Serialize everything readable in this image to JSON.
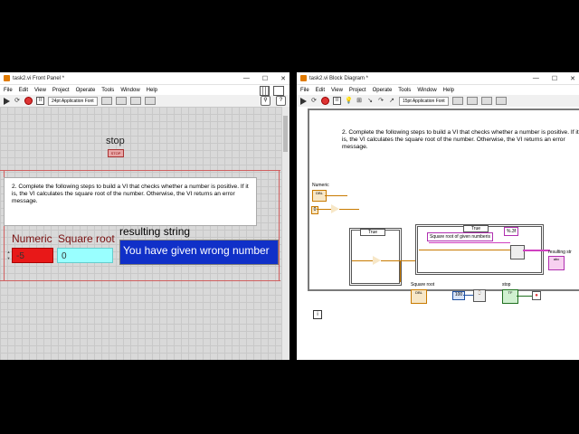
{
  "front_panel": {
    "title": "task2.vi Front Panel *",
    "menu": [
      "File",
      "Edit",
      "View",
      "Project",
      "Operate",
      "Tools",
      "Window",
      "Help"
    ],
    "font_select": "24pt Application Font",
    "stop_label": "stop",
    "stop_button_text": "STOP",
    "instructions": "2.  Complete the following steps to build a VI that checks whether a number is positive. If it is, the VI calculates the square root of the number. Otherwise, the VI returns an error message.",
    "numeric_label": "Numeric",
    "numeric_value": "-5",
    "square_root_label": "Square root",
    "square_root_value": "0",
    "resulting_string_label": "resulting string",
    "resulting_string_value": "You have given wrong number"
  },
  "block_diagram": {
    "title": "task2.vi Block Diagram *",
    "menu": [
      "File",
      "Edit",
      "View",
      "Project",
      "Operate",
      "Tools",
      "Window",
      "Help"
    ],
    "font_select": "15pt Application Font",
    "instructions": "2.  Complete the following steps to build a VI that checks whether a number is positive. If it is, the VI calculates the square root of the number. Otherwise, the VI returns an error message.",
    "numeric_label": "Numeric",
    "numeric_const": "0",
    "case1_selector": "True",
    "case2_selector": "True",
    "string_const": "Square root of given numberis",
    "format_const": "%.3f",
    "square_root_label": "Square root",
    "resulting_string_label": "resulting str",
    "wait_const": "100",
    "stop_label": "stop",
    "scroll_value": "0.1"
  },
  "colors": {
    "numeric_bg": "#e81818",
    "square_root_bg": "#99ffff",
    "result_bg": "#1030c8",
    "wire_orange": "#c87a00",
    "wire_pink": "#d040c0"
  }
}
